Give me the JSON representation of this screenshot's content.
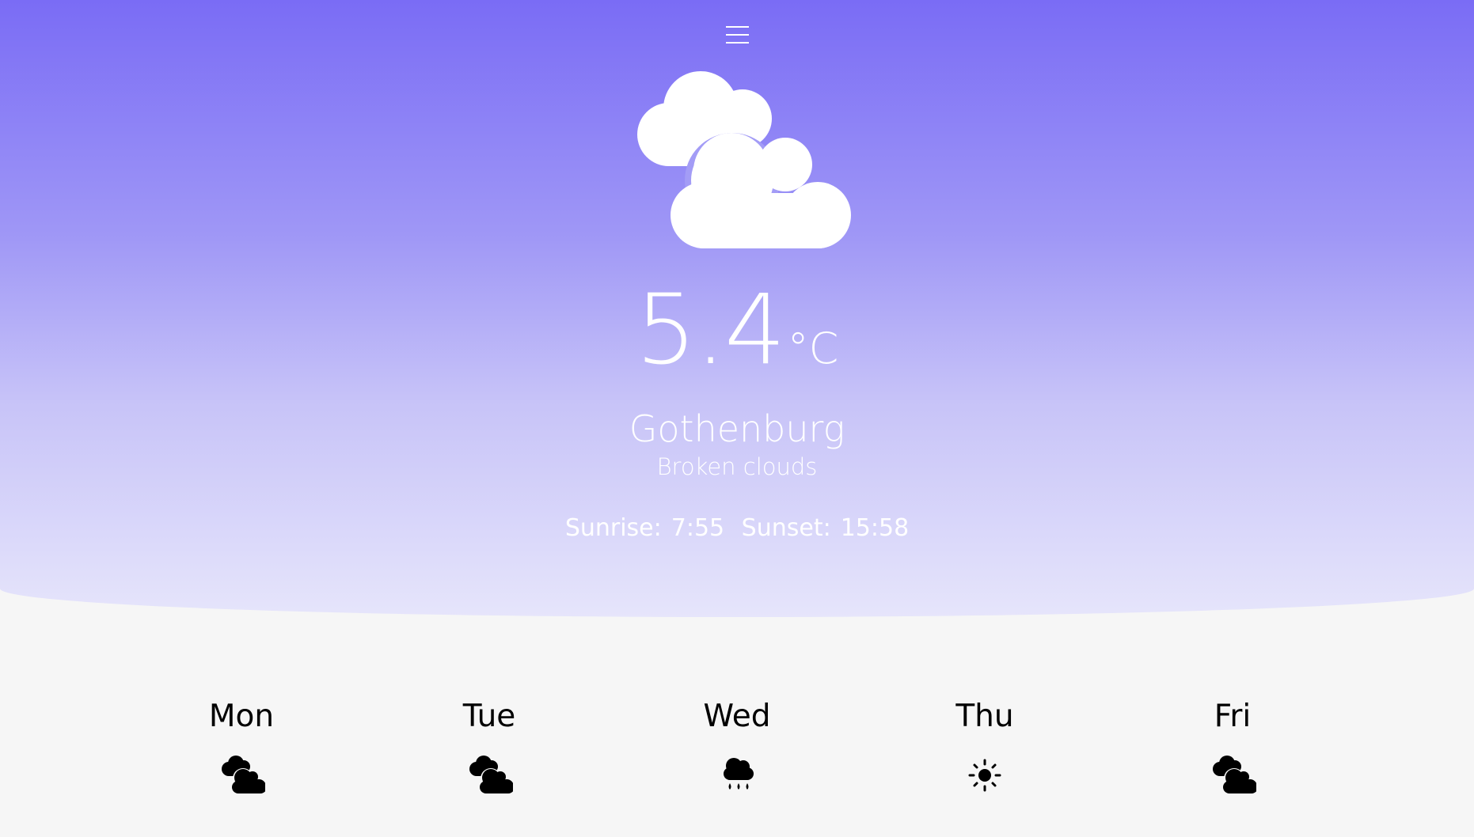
{
  "header": {
    "menu_icon": "hamburger-menu-icon"
  },
  "current": {
    "icon": "broken-clouds-icon",
    "temperature": "5.4",
    "unit": "°C",
    "city": "Gothenburg",
    "description": "Broken clouds",
    "sunrise_label": "Sunrise:",
    "sunrise": "7:55",
    "sunset_label": "Sunset:",
    "sunset": "15:58"
  },
  "forecast": [
    {
      "day": "Mon",
      "icon": "broken-clouds-icon"
    },
    {
      "day": "Tue",
      "icon": "broken-clouds-icon"
    },
    {
      "day": "Wed",
      "icon": "rain-icon"
    },
    {
      "day": "Thu",
      "icon": "sun-icon"
    },
    {
      "day": "Fri",
      "icon": "broken-clouds-icon"
    }
  ],
  "colors": {
    "gradient_top": "#7a6cf5",
    "gradient_bottom": "#e6e5fb",
    "background": "#f6f6f6"
  }
}
